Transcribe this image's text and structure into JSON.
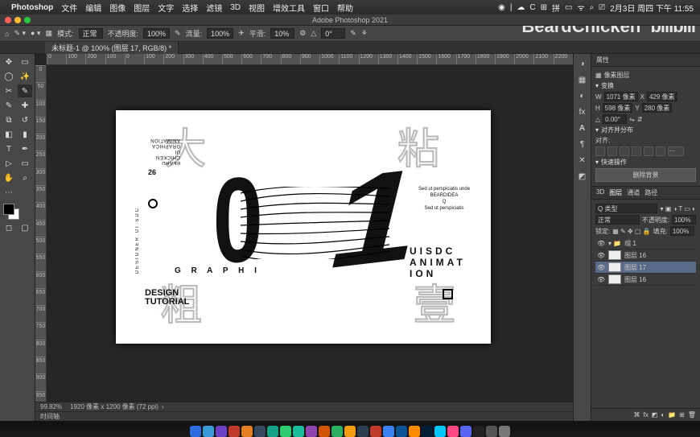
{
  "watermark": {
    "brand": "BeardChicken",
    "bili": "bilibili"
  },
  "menubar": {
    "app": "Photoshop",
    "items": [
      "文件",
      "编辑",
      "图像",
      "图层",
      "文字",
      "选择",
      "滤镜",
      "3D",
      "视图",
      "增效工具",
      "窗口",
      "帮助"
    ],
    "clock": "2月3日 周四 下午 11:55"
  },
  "titlebar": {
    "title": "Adobe Photoshop 2021"
  },
  "options": {
    "mode_label": "模式:",
    "mode_value": "正常",
    "opacity_label": "不透明度:",
    "opacity_value": "100%",
    "flow_label": "流量:",
    "flow_value": "100%",
    "smooth_label": "平滑:",
    "smooth_value": "10%",
    "angle_label": "",
    "angle_value": "0°"
  },
  "tab": {
    "title": "未标题-1 @ 100% (图层 17, RGB/8) *"
  },
  "rulers_h": [
    "0",
    "100",
    "200",
    "100",
    "0",
    "100",
    "200",
    "300",
    "400",
    "500",
    "600",
    "700",
    "800",
    "900",
    "1000",
    "1100",
    "1200",
    "1300",
    "1400",
    "1500",
    "1600",
    "1700",
    "1800",
    "1900",
    "2000",
    "2100",
    "2200"
  ],
  "rulers_v": [
    "0",
    "50",
    "100",
    "150",
    "200",
    "250",
    "300",
    "350",
    "400",
    "450",
    "500",
    "550",
    "600",
    "650",
    "700",
    "750",
    "800",
    "850",
    "900",
    "950"
  ],
  "artboard": {
    "rotated": "BEARD\nCHICKEN\nUI\nGRAPHICA\nANIMATION",
    "num": "26",
    "vtext": "DESIGNER UI SDC",
    "graphi": "G R A P H I",
    "uisdc": "UISDC\nANIMAT\nION",
    "mini": "Sed ut perspiciatis unde\nBEARDIDEA\nQ\nSed ut perspiciatis",
    "design": "DESIGN\nTUTORIAL",
    "outline1": "大",
    "outline2": "粘",
    "outline3": "粗",
    "outline4": "壹"
  },
  "status": {
    "zoom": "99.82%",
    "dims": "1920 像素 x 1200 像素 (72 ppi)",
    "timeline": "时间轴"
  },
  "panels": {
    "props_title": "属性",
    "props_sub": "像素图层",
    "transform": "变换",
    "W": "1071 像素",
    "X": "429 像素",
    "H": "598 像素",
    "Y": "280 像素",
    "angle": "0.00°",
    "align_title": "对齐并分布",
    "align_sub": "对齐:",
    "quick_title": "快速操作",
    "remove_bg": "删除背景",
    "layers_tabs": [
      "3D",
      "图层",
      "通道",
      "路径"
    ],
    "ltype": "Q 类型",
    "blend": "正常",
    "lopacity_label": "不透明度:",
    "lopacity": "100%",
    "lock_label": "锁定:",
    "fill_label": "填充:",
    "fill": "100%",
    "folder": "组 1",
    "layers": [
      {
        "name": "图层 16"
      },
      {
        "name": "图层 17",
        "sel": true
      },
      {
        "name": "图层 16"
      }
    ]
  },
  "dock_colors": [
    "#2d6cdf",
    "#3a9bd8",
    "#6b42c7",
    "#c0392b",
    "#e67e22",
    "#34495e",
    "#16a085",
    "#2ecc71",
    "#1abc9c",
    "#8e44ad",
    "#d35400",
    "#27ae60",
    "#f39c12",
    "#2c3e50",
    "#c0392b",
    "#3b82f6",
    "#0b5394",
    "#ff8a00",
    "#001e36",
    "#00c8ff",
    "#ff4785",
    "#5865f2",
    "#222",
    "#555",
    "#777"
  ]
}
